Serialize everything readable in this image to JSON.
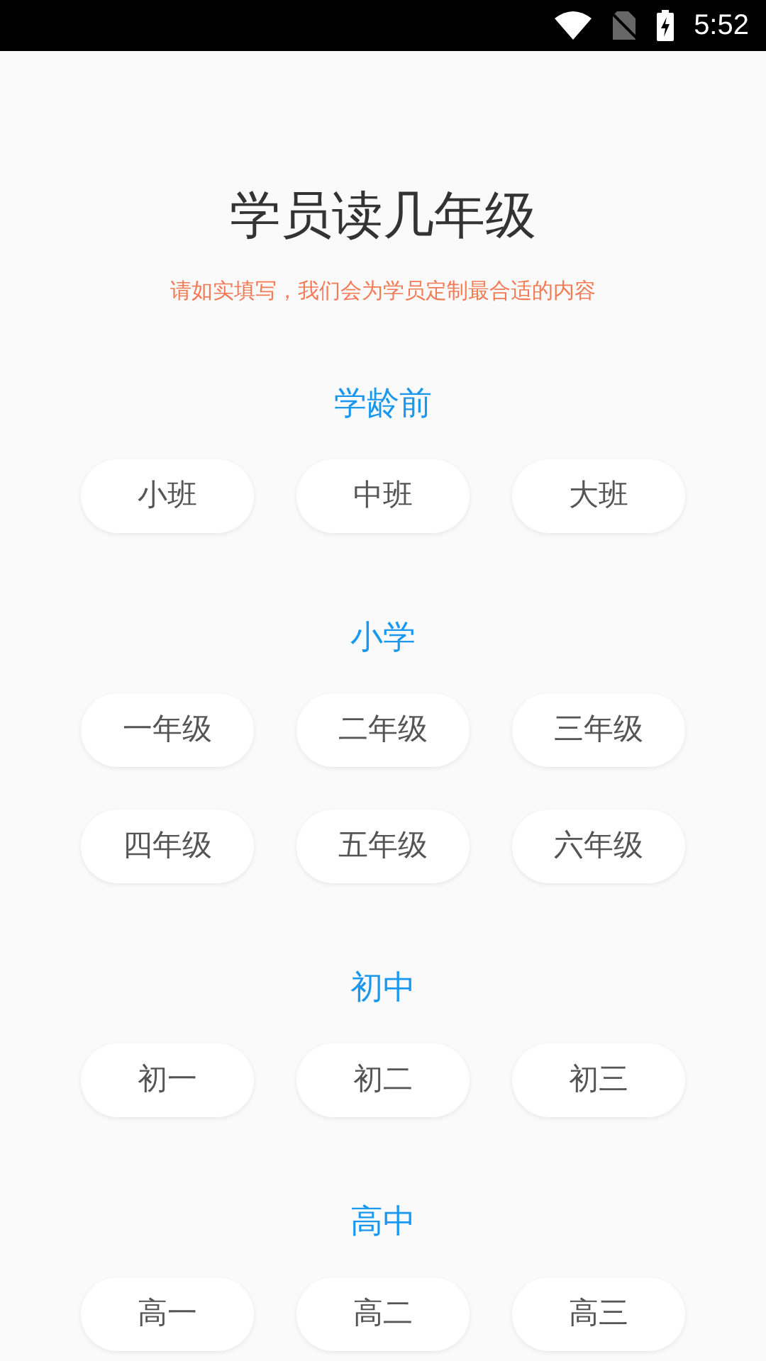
{
  "status_bar": {
    "time": "5:52"
  },
  "title": "学员读几年级",
  "subtitle": "请如实填写，我们会为学员定制最合适的内容",
  "sections": [
    {
      "heading": "学龄前",
      "options": [
        "小班",
        "中班",
        "大班"
      ]
    },
    {
      "heading": "小学",
      "options": [
        "一年级",
        "二年级",
        "三年级",
        "四年级",
        "五年级",
        "六年级"
      ]
    },
    {
      "heading": "初中",
      "options": [
        "初一",
        "初二",
        "初三"
      ]
    },
    {
      "heading": "高中",
      "options": [
        "高一",
        "高二",
        "高三"
      ]
    }
  ]
}
